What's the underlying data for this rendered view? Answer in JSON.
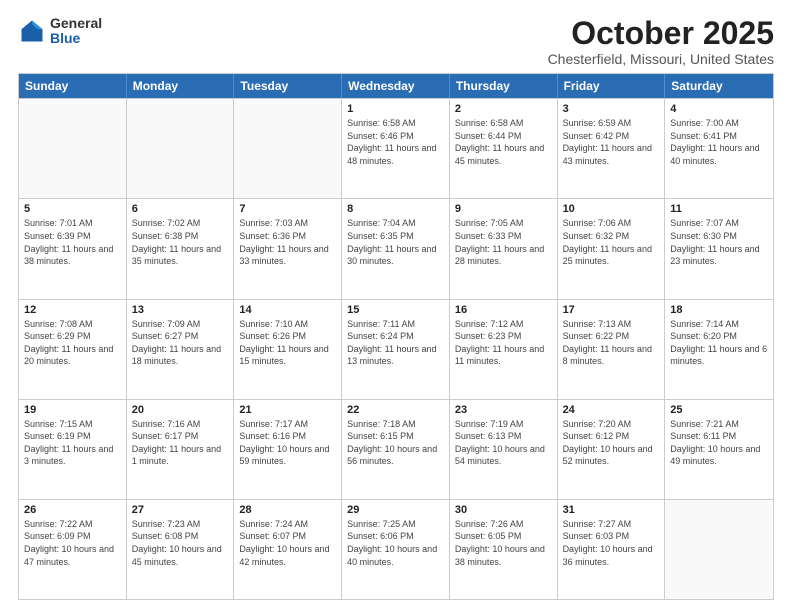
{
  "logo": {
    "general": "General",
    "blue": "Blue"
  },
  "header": {
    "month": "October 2025",
    "location": "Chesterfield, Missouri, United States"
  },
  "weekdays": [
    "Sunday",
    "Monday",
    "Tuesday",
    "Wednesday",
    "Thursday",
    "Friday",
    "Saturday"
  ],
  "rows": [
    [
      {
        "day": "",
        "info": ""
      },
      {
        "day": "",
        "info": ""
      },
      {
        "day": "",
        "info": ""
      },
      {
        "day": "1",
        "info": "Sunrise: 6:58 AM\nSunset: 6:46 PM\nDaylight: 11 hours and 48 minutes."
      },
      {
        "day": "2",
        "info": "Sunrise: 6:58 AM\nSunset: 6:44 PM\nDaylight: 11 hours and 45 minutes."
      },
      {
        "day": "3",
        "info": "Sunrise: 6:59 AM\nSunset: 6:42 PM\nDaylight: 11 hours and 43 minutes."
      },
      {
        "day": "4",
        "info": "Sunrise: 7:00 AM\nSunset: 6:41 PM\nDaylight: 11 hours and 40 minutes."
      }
    ],
    [
      {
        "day": "5",
        "info": "Sunrise: 7:01 AM\nSunset: 6:39 PM\nDaylight: 11 hours and 38 minutes."
      },
      {
        "day": "6",
        "info": "Sunrise: 7:02 AM\nSunset: 6:38 PM\nDaylight: 11 hours and 35 minutes."
      },
      {
        "day": "7",
        "info": "Sunrise: 7:03 AM\nSunset: 6:36 PM\nDaylight: 11 hours and 33 minutes."
      },
      {
        "day": "8",
        "info": "Sunrise: 7:04 AM\nSunset: 6:35 PM\nDaylight: 11 hours and 30 minutes."
      },
      {
        "day": "9",
        "info": "Sunrise: 7:05 AM\nSunset: 6:33 PM\nDaylight: 11 hours and 28 minutes."
      },
      {
        "day": "10",
        "info": "Sunrise: 7:06 AM\nSunset: 6:32 PM\nDaylight: 11 hours and 25 minutes."
      },
      {
        "day": "11",
        "info": "Sunrise: 7:07 AM\nSunset: 6:30 PM\nDaylight: 11 hours and 23 minutes."
      }
    ],
    [
      {
        "day": "12",
        "info": "Sunrise: 7:08 AM\nSunset: 6:29 PM\nDaylight: 11 hours and 20 minutes."
      },
      {
        "day": "13",
        "info": "Sunrise: 7:09 AM\nSunset: 6:27 PM\nDaylight: 11 hours and 18 minutes."
      },
      {
        "day": "14",
        "info": "Sunrise: 7:10 AM\nSunset: 6:26 PM\nDaylight: 11 hours and 15 minutes."
      },
      {
        "day": "15",
        "info": "Sunrise: 7:11 AM\nSunset: 6:24 PM\nDaylight: 11 hours and 13 minutes."
      },
      {
        "day": "16",
        "info": "Sunrise: 7:12 AM\nSunset: 6:23 PM\nDaylight: 11 hours and 11 minutes."
      },
      {
        "day": "17",
        "info": "Sunrise: 7:13 AM\nSunset: 6:22 PM\nDaylight: 11 hours and 8 minutes."
      },
      {
        "day": "18",
        "info": "Sunrise: 7:14 AM\nSunset: 6:20 PM\nDaylight: 11 hours and 6 minutes."
      }
    ],
    [
      {
        "day": "19",
        "info": "Sunrise: 7:15 AM\nSunset: 6:19 PM\nDaylight: 11 hours and 3 minutes."
      },
      {
        "day": "20",
        "info": "Sunrise: 7:16 AM\nSunset: 6:17 PM\nDaylight: 11 hours and 1 minute."
      },
      {
        "day": "21",
        "info": "Sunrise: 7:17 AM\nSunset: 6:16 PM\nDaylight: 10 hours and 59 minutes."
      },
      {
        "day": "22",
        "info": "Sunrise: 7:18 AM\nSunset: 6:15 PM\nDaylight: 10 hours and 56 minutes."
      },
      {
        "day": "23",
        "info": "Sunrise: 7:19 AM\nSunset: 6:13 PM\nDaylight: 10 hours and 54 minutes."
      },
      {
        "day": "24",
        "info": "Sunrise: 7:20 AM\nSunset: 6:12 PM\nDaylight: 10 hours and 52 minutes."
      },
      {
        "day": "25",
        "info": "Sunrise: 7:21 AM\nSunset: 6:11 PM\nDaylight: 10 hours and 49 minutes."
      }
    ],
    [
      {
        "day": "26",
        "info": "Sunrise: 7:22 AM\nSunset: 6:09 PM\nDaylight: 10 hours and 47 minutes."
      },
      {
        "day": "27",
        "info": "Sunrise: 7:23 AM\nSunset: 6:08 PM\nDaylight: 10 hours and 45 minutes."
      },
      {
        "day": "28",
        "info": "Sunrise: 7:24 AM\nSunset: 6:07 PM\nDaylight: 10 hours and 42 minutes."
      },
      {
        "day": "29",
        "info": "Sunrise: 7:25 AM\nSunset: 6:06 PM\nDaylight: 10 hours and 40 minutes."
      },
      {
        "day": "30",
        "info": "Sunrise: 7:26 AM\nSunset: 6:05 PM\nDaylight: 10 hours and 38 minutes."
      },
      {
        "day": "31",
        "info": "Sunrise: 7:27 AM\nSunset: 6:03 PM\nDaylight: 10 hours and 36 minutes."
      },
      {
        "day": "",
        "info": ""
      }
    ]
  ]
}
